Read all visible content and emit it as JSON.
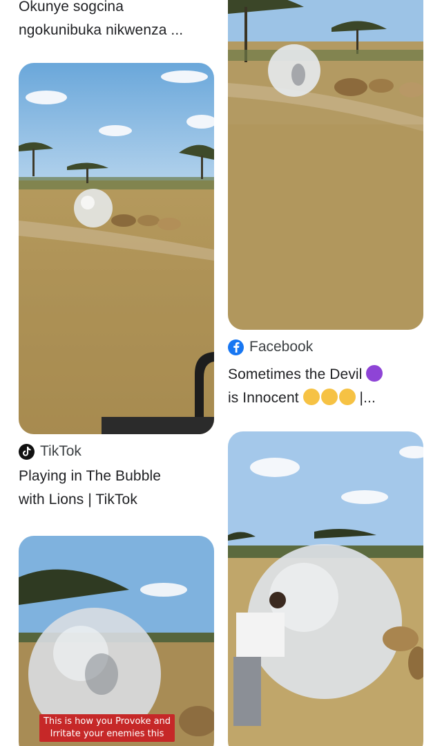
{
  "results": [
    {
      "id": "top-left",
      "title_line1": "Okunye sogcina",
      "title_line2": "ngokunibuka nikwenza ..."
    },
    {
      "id": "tiktok",
      "source": "TikTok",
      "source_icon": "tiktok-icon",
      "title_line1": "Playing in The Bubble",
      "title_line2": "with Lions | TikTok"
    },
    {
      "id": "facebook",
      "source": "Facebook",
      "source_icon": "facebook-icon",
      "title_line1": "Sometimes the Devil",
      "title_line2_text": "is Innocent",
      "title_line2_suffix": "|..."
    },
    {
      "id": "bottom-left",
      "overlay_caption": "This is how you Provoke and Irritate your enemies this"
    }
  ],
  "colors": {
    "tiktok_icon": "#111111",
    "facebook_icon": "#1877f2",
    "caption_red": "#c62828"
  }
}
